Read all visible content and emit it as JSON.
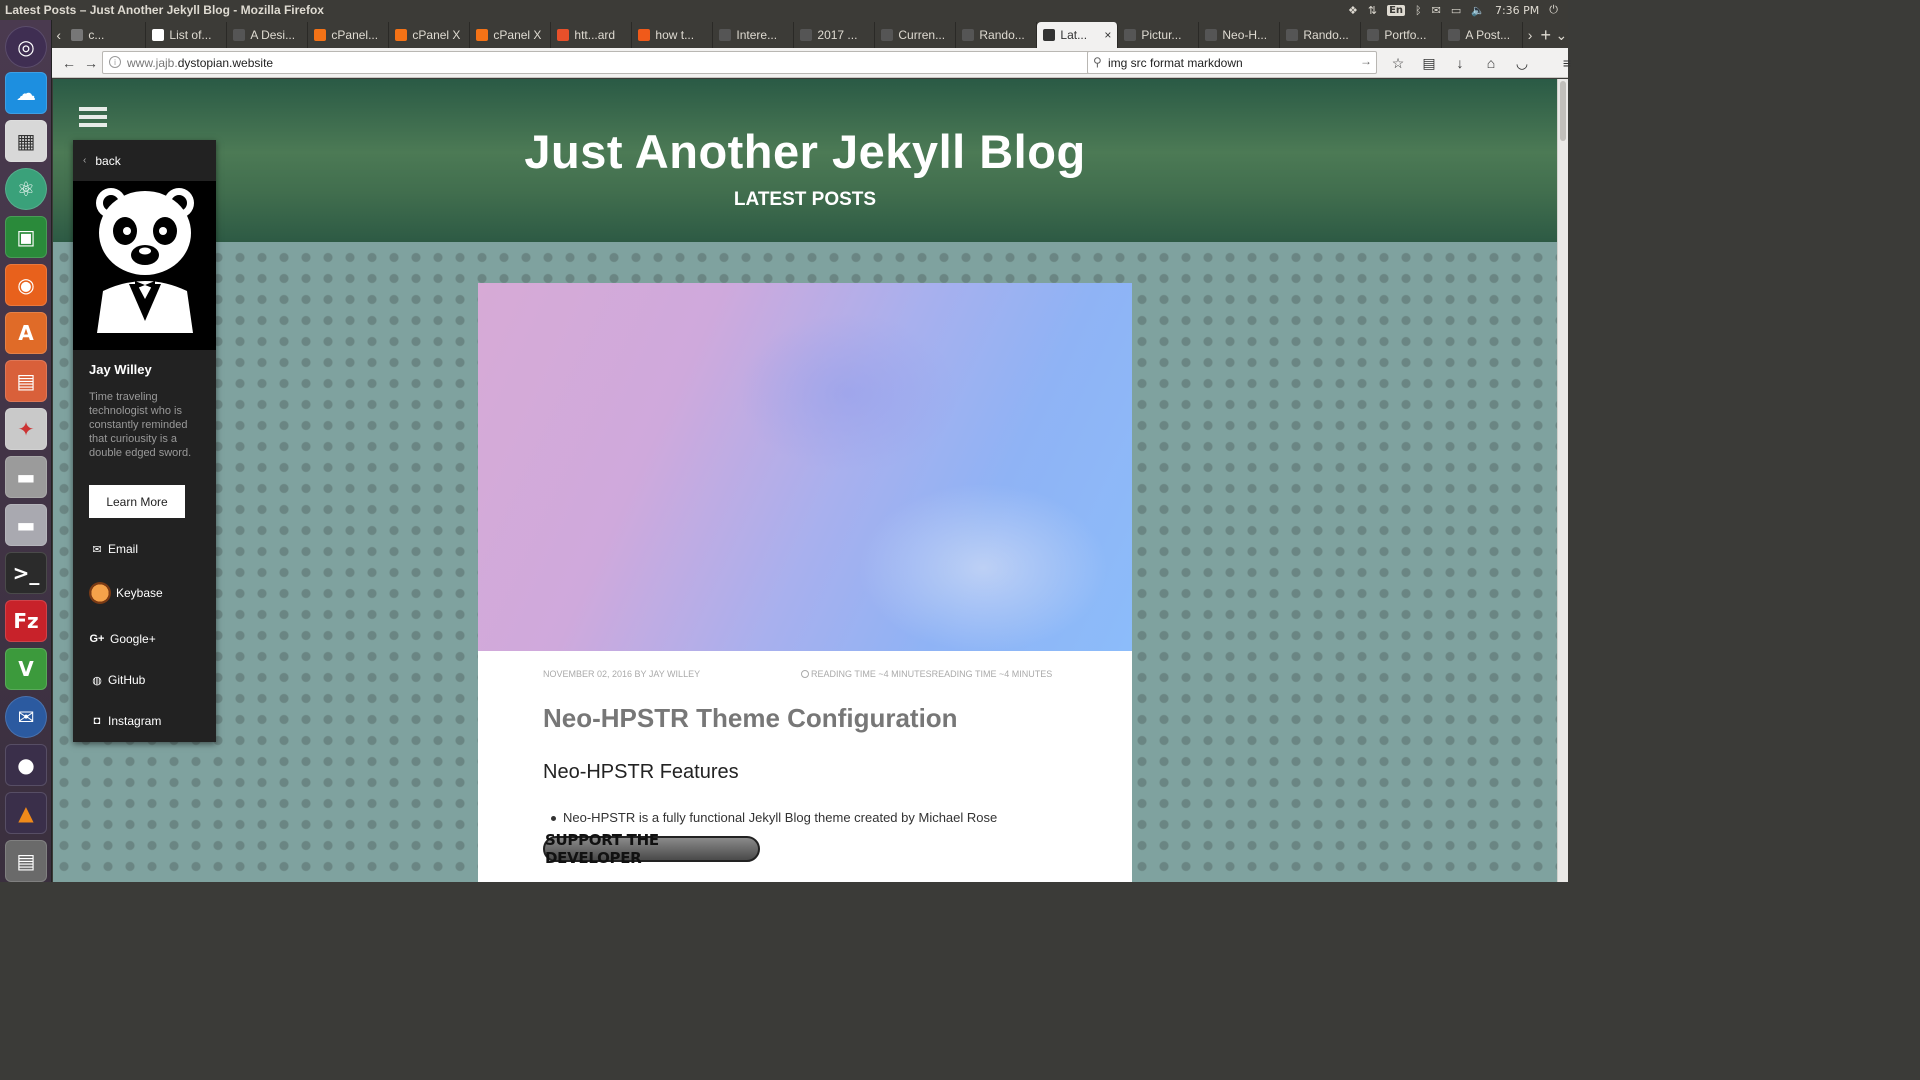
{
  "window": {
    "title": "Latest Posts – Just Another Jekyll Blog - Mozilla Firefox"
  },
  "tray": {
    "lang": "En",
    "time": "7:36 PM"
  },
  "tabs": [
    {
      "label": "c...",
      "icon": "blank-icon",
      "color": "#777777"
    },
    {
      "label": "List of...",
      "icon": "wikipedia-icon",
      "color": "#ffffff"
    },
    {
      "label": "A Desi...",
      "icon": "bird-icon",
      "color": "#555555"
    },
    {
      "label": "cPanel...",
      "icon": "cpanel-icon",
      "color": "#f47216"
    },
    {
      "label": "cPanel X",
      "icon": "cpanel-icon",
      "color": "#f47216"
    },
    {
      "label": "cPanel X",
      "icon": "cpanel-icon",
      "color": "#f47216"
    },
    {
      "label": "htt...ard",
      "icon": "wave-icon",
      "color": "#e8502a"
    },
    {
      "label": "how t...",
      "icon": "reddit-icon",
      "color": "#f05a1a"
    },
    {
      "label": "Intere...",
      "icon": "page-icon",
      "color": "#555555"
    },
    {
      "label": "2017 ...",
      "icon": "page-icon",
      "color": "#555555"
    },
    {
      "label": "Curren...",
      "icon": "page-icon",
      "color": "#555555"
    },
    {
      "label": "Rando...",
      "icon": "page-icon",
      "color": "#555555"
    },
    {
      "label": "Lat...",
      "icon": "page-icon",
      "color": "#333333",
      "active": true
    },
    {
      "label": "Pictur...",
      "icon": "page-icon",
      "color": "#555555"
    },
    {
      "label": "Neo-H...",
      "icon": "page-icon",
      "color": "#555555"
    },
    {
      "label": "Rando...",
      "icon": "page-icon",
      "color": "#555555"
    },
    {
      "label": "Portfo...",
      "icon": "page-icon",
      "color": "#555555"
    },
    {
      "label": "A Post...",
      "icon": "page-icon",
      "color": "#555555"
    }
  ],
  "nav": {
    "url_prefix": "www.jajb.",
    "url_domain": "dystopian.website",
    "search_value": "img src format markdown"
  },
  "blog": {
    "title": "Just Another Jekyll Blog",
    "subtitle": "LATEST POSTS"
  },
  "sidebar": {
    "back_label": "back",
    "name": "Jay Willey",
    "bio": "Time traveling technologist who is constantly reminded that curiousity is a double edged sword.",
    "learn_more": "Learn More",
    "links": [
      {
        "label": "Email",
        "icon": "envelope-icon"
      },
      {
        "label": "Keybase",
        "icon": "keybase-icon"
      },
      {
        "label": "Google+",
        "icon": "google-plus-icon"
      },
      {
        "label": "GitHub",
        "icon": "github-icon"
      },
      {
        "label": "Instagram",
        "icon": "instagram-icon"
      }
    ]
  },
  "post": {
    "meta_date": "NOVEMBER 02, 2016 BY JAY WILLEY",
    "meta_reading": "READING TIME ~4 MINUTESREADING TIME ~4 MINUTES",
    "title": "Neo-HPSTR Theme Configuration",
    "heading": "Neo-HPSTR Features",
    "bullet": "Neo-HPSTR is a fully functional Jekyll Blog theme created by Michael Rose",
    "support_label": "SUPPORT THE DEVELOPER"
  },
  "colors": {
    "sidebar_bg": "#222222",
    "hero_green": "#4c7a55",
    "page_bg": "#7fa29f"
  }
}
